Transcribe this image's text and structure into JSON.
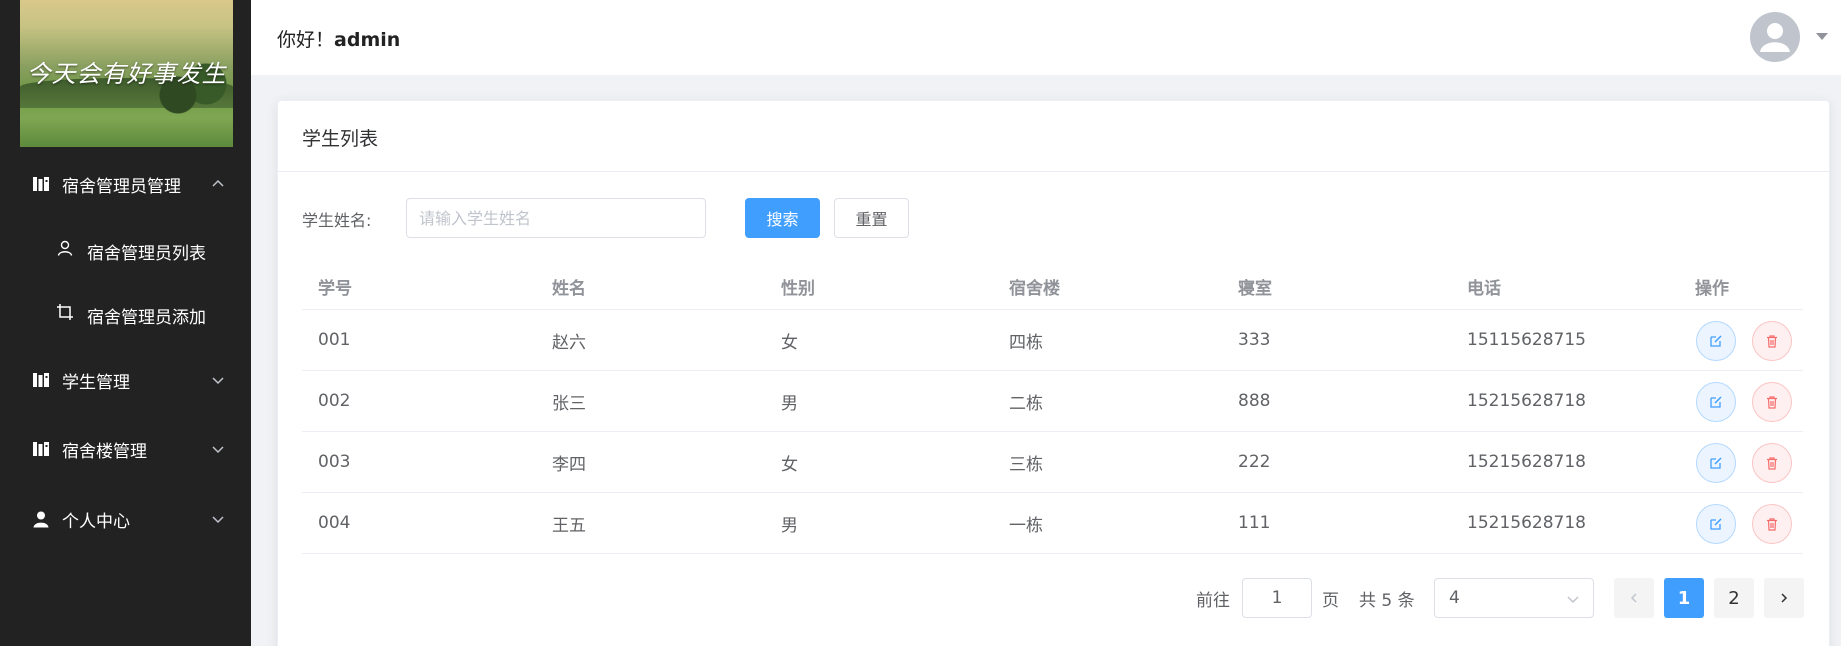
{
  "sidebar": {
    "logo_text": "今天会有好事发生",
    "menu": [
      {
        "label": "宿舍管理员管理",
        "icon": "building-icon",
        "expanded": true
      },
      {
        "label": "学生管理",
        "icon": "building-icon",
        "expanded": false
      },
      {
        "label": "宿舍楼管理",
        "icon": "building-icon",
        "expanded": false
      },
      {
        "label": "个人中心",
        "icon": "user-icon",
        "expanded": false
      }
    ],
    "submenu": [
      {
        "label": "宿舍管理员列表",
        "icon": "user-outline-icon"
      },
      {
        "label": "宿舍管理员添加",
        "icon": "crop-icon"
      }
    ]
  },
  "header": {
    "greeting": "你好！",
    "username": "admin"
  },
  "card": {
    "title": "学生列表",
    "search": {
      "label": "学生姓名:",
      "placeholder": "请输入学生姓名",
      "value": ""
    },
    "search_button": "搜索",
    "reset_button": "重置"
  },
  "table": {
    "columns": [
      "学号",
      "姓名",
      "性别",
      "宿舍楼",
      "寝室",
      "电话",
      "操作"
    ],
    "rows": [
      [
        "001",
        "赵六",
        "女",
        "四栋",
        "333",
        "15115628715"
      ],
      [
        "002",
        "张三",
        "男",
        "二栋",
        "888",
        "15215628718"
      ],
      [
        "003",
        "李四",
        "女",
        "三栋",
        "222",
        "15215628718"
      ],
      [
        "004",
        "王五",
        "男",
        "一栋",
        "111",
        "15215628718"
      ]
    ]
  },
  "pagination": {
    "goto_label": "前往",
    "current_page": "1",
    "page_unit": "页",
    "total": "共 5 条",
    "page_size": "4",
    "pages": [
      "1",
      "2"
    ]
  },
  "colors": {
    "sidebar_bg": "#222222",
    "primary": "#409eff",
    "danger": "#f56c6c"
  }
}
